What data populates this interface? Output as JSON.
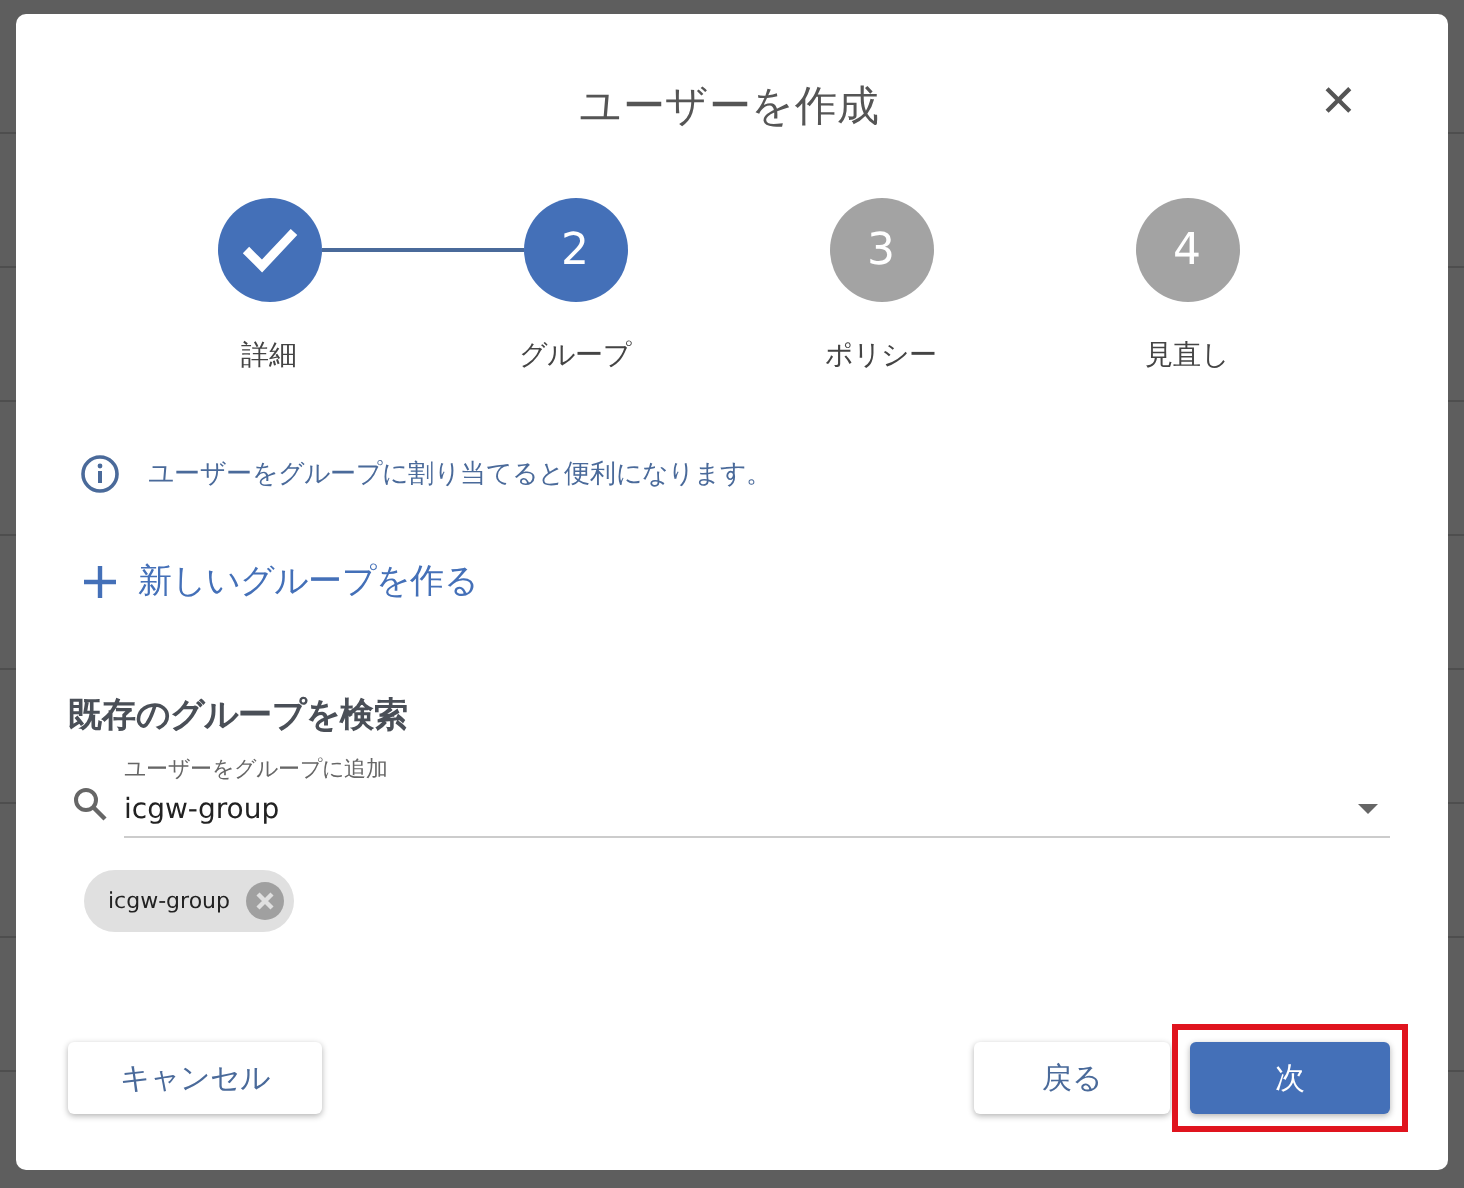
{
  "dialog": {
    "title": "ユーザーを作成",
    "close_label": "✕"
  },
  "steps": [
    {
      "label": "詳細",
      "completed": true,
      "selected": false
    },
    {
      "number": "2",
      "label": "グループ",
      "completed": false,
      "selected": true
    },
    {
      "number": "3",
      "label": "ポリシー",
      "completed": false,
      "selected": false
    },
    {
      "number": "4",
      "label": "見直し",
      "completed": false,
      "selected": false
    }
  ],
  "info": "ユーザーをグループに割り当てると便利になります。",
  "create_group_link": "新しいグループを作る",
  "search_section": {
    "heading": "既存のグループを検索",
    "field_label": "ユーザーをグループに追加",
    "value": "icgw-group"
  },
  "chips": [
    {
      "label": "icgw-group"
    }
  ],
  "buttons": [
    {
      "label": "キャンセル",
      "kind": "secondary",
      "highlighted": false
    },
    {
      "label": "戻る",
      "kind": "secondary",
      "highlighted": false
    },
    {
      "label": "次",
      "kind": "primary",
      "highlighted": true
    }
  ]
}
